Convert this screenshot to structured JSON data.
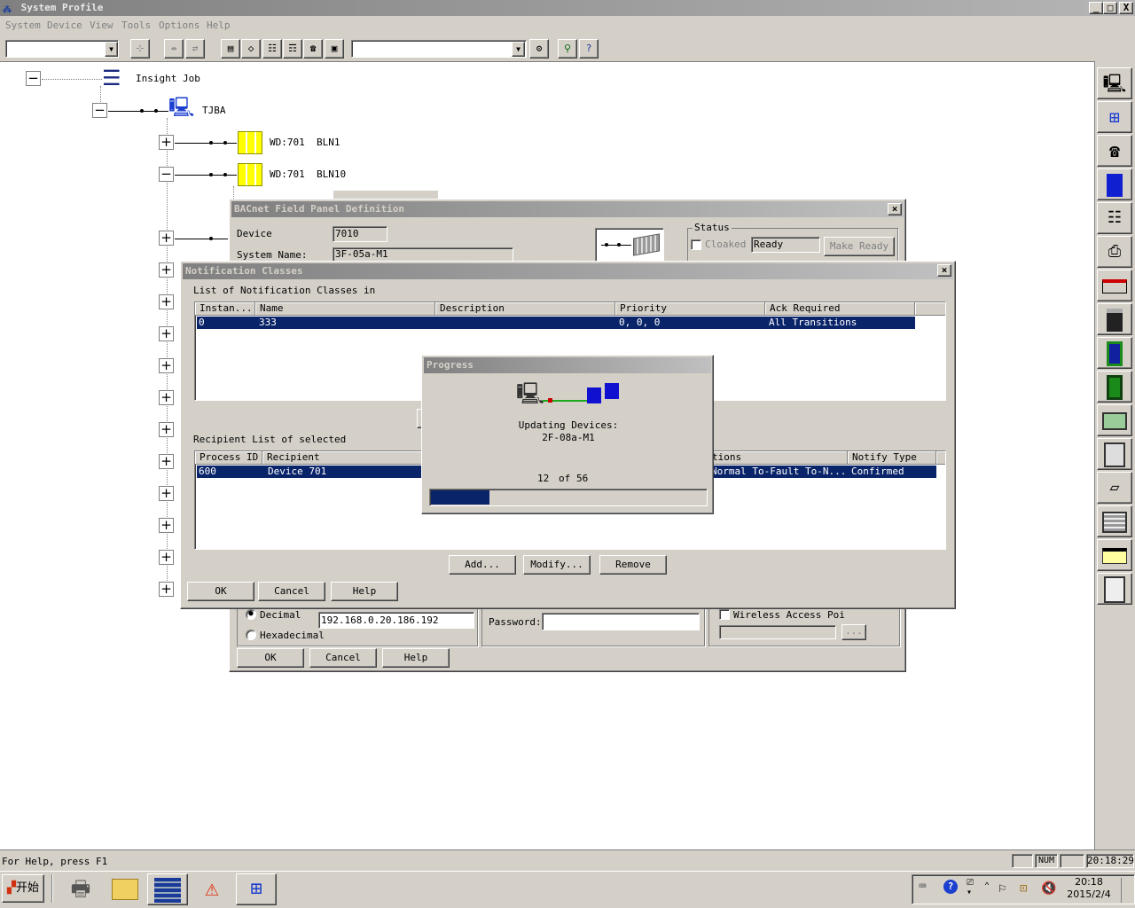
{
  "window": {
    "title": "System Profile",
    "min": "_",
    "max": "□",
    "close": "X"
  },
  "menu": [
    "System",
    "Device",
    "View",
    "Tools",
    "Options",
    "Help"
  ],
  "tree": {
    "root": "Insight Job",
    "child": "TJBA",
    "nodes": [
      {
        "type": "WD:701",
        "name": "BLN1"
      },
      {
        "type": "WD:701",
        "name": "BLN10"
      }
    ]
  },
  "bacnet": {
    "title": "BACnet Field Panel Definition",
    "device_label": "Device",
    "device_value": "7010",
    "system_name_label": "System Name:",
    "system_name_value": "3F-05a-M1",
    "status_label": "Status",
    "cloaked_label": "Cloaked",
    "status_value": "Ready",
    "make_ready": "Make Ready",
    "decimal_label": "Decimal",
    "hex_label": "Hexadecimal",
    "ip_value": "192.168.0.20.186.192",
    "password_label": "Password:",
    "wireless_label": "Wireless Access Poi",
    "browse_btn": "...",
    "ok": "OK",
    "cancel": "Cancel",
    "help": "Help"
  },
  "notif": {
    "title": "Notification Classes",
    "list_label": "List of Notification Classes in",
    "columns": [
      "Instan...",
      "Name",
      "Description",
      "Priority",
      "Ack Required"
    ],
    "rows": [
      [
        "0",
        "333",
        "",
        "0, 0, 0",
        "All Transitions"
      ]
    ],
    "recipient_label": "Recipient List of selected",
    "rcols": [
      "Process ID",
      "Recipient",
      "tions",
      "Notify Type"
    ],
    "rrows": [
      [
        "600",
        "Device 701",
        "Normal To-Fault To-N...",
        "Confirmed"
      ]
    ],
    "add": "Add...",
    "modify": "Modify...",
    "remove": "Remove",
    "ok": "OK",
    "cancel": "Cancel",
    "help": "Help"
  },
  "progress": {
    "title": "Progress",
    "line1": "Updating Devices:",
    "line2": "2F-08a-M1",
    "current": "12",
    "of": "of",
    "total": "56",
    "fraction": 0.214
  },
  "statusbar": {
    "help": "For Help, press F1",
    "num": "NUM",
    "time": "20:18:29"
  },
  "taskbar": {
    "start": "开始",
    "clock_time": "20:18",
    "clock_date": "2015/2/4"
  },
  "colors": {
    "selection": "#0a246a",
    "title_inactive": "#808080",
    "face": "#d4d0c8"
  }
}
